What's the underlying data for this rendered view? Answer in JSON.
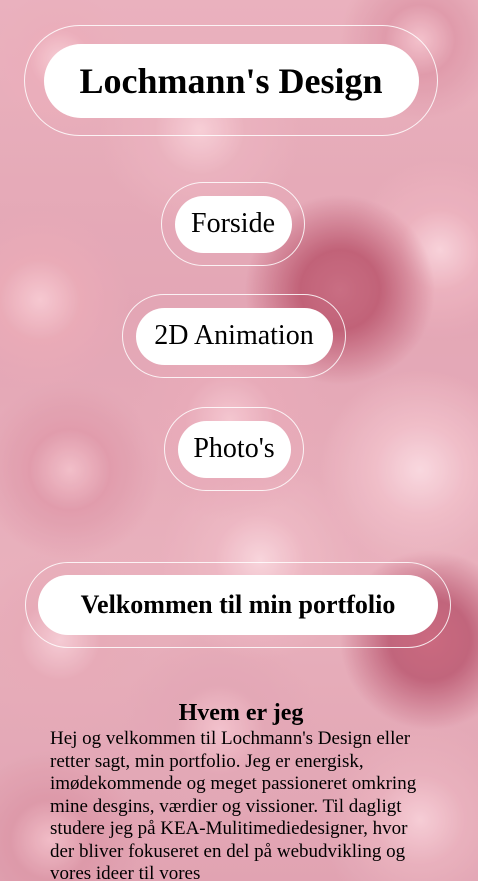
{
  "header": {
    "title": "Lochmann's Design"
  },
  "nav": {
    "items": [
      {
        "label": "Forside"
      },
      {
        "label": "2D Animation"
      },
      {
        "label": "Photo's"
      }
    ]
  },
  "welcome": {
    "text": "Velkommen til min portfolio"
  },
  "about": {
    "heading": "Hvem er jeg",
    "text": "Hej og velkommen til Lochmann's Design eller retter sagt, min portfolio. Jeg er energisk, imødekommende og meget passioneret omkring mine desgins, værdier og vissioner. Til dagligt studere jeg på KEA-Mulitimediedesigner, hvor der bliver fokuseret en del på webudvikling og vores ideer til vores"
  }
}
